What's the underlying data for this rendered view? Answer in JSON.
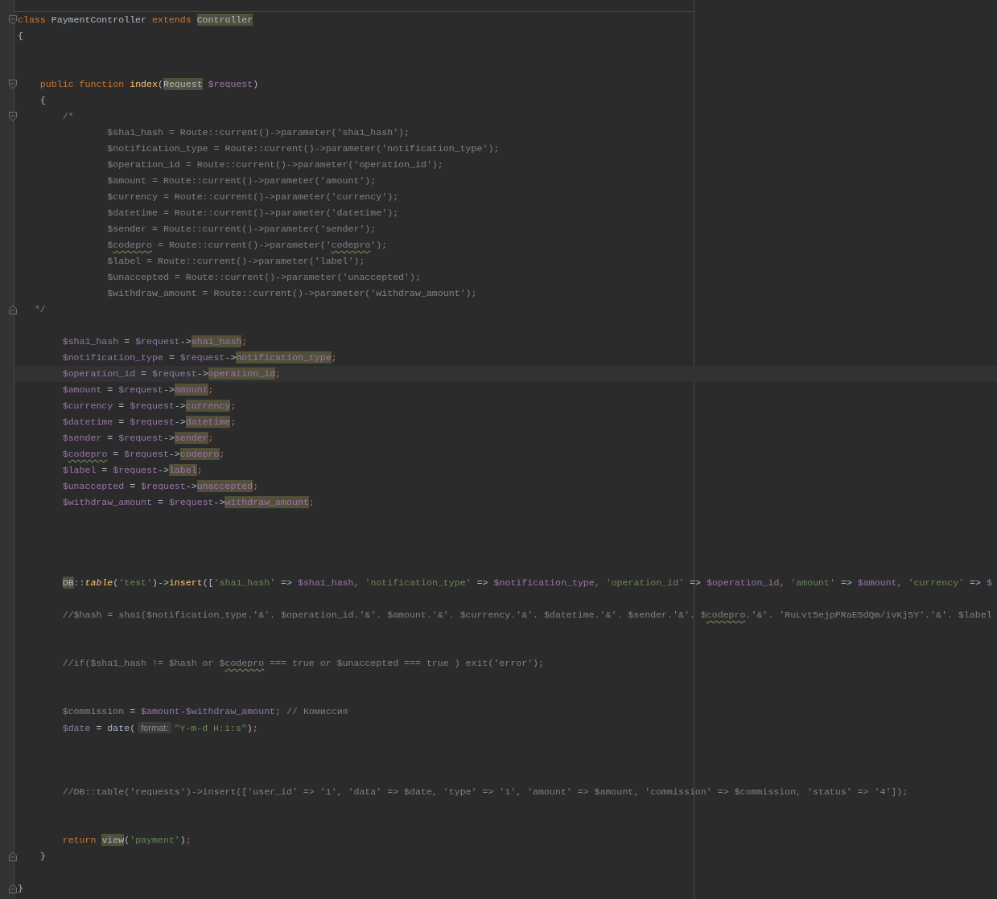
{
  "editor": {
    "lines": [
      {
        "current": false,
        "fold": {
          "kind": "start"
        },
        "tokens": [
          {
            "text": "class ",
            "kind": "kw"
          },
          {
            "text": "PaymentController ",
            "kind": "plain"
          },
          {
            "text": "extends ",
            "kind": "kw"
          },
          {
            "text": "Controller",
            "kind": "hl"
          }
        ]
      },
      {
        "current": false,
        "tokens": [
          {
            "text": "{",
            "kind": "plain"
          }
        ]
      },
      {
        "current": false
      },
      {
        "current": false
      },
      {
        "current": false,
        "fold": {
          "kind": "start"
        },
        "tokens": [
          {
            "text": "    public function ",
            "kind": "kw"
          },
          {
            "text": "index",
            "kind": "fn"
          },
          {
            "text": "(",
            "kind": "plain"
          },
          {
            "text": "Request",
            "kind": "hl"
          },
          {
            "text": " $request",
            "kind": "var"
          },
          {
            "text": ")",
            "kind": "plain"
          }
        ]
      },
      {
        "current": false,
        "tokens": [
          {
            "text": "    {",
            "kind": "plain"
          }
        ]
      },
      {
        "current": false,
        "fold": {
          "kind": "start"
        },
        "tokens": [
          {
            "text": "        /*",
            "kind": "cmt"
          }
        ]
      },
      {
        "current": false,
        "tokens": [
          {
            "text": "                $sha1_hash = Route::current()->parameter('sha1_hash');",
            "kind": "cmt"
          }
        ]
      },
      {
        "current": false,
        "tokens": [
          {
            "text": "                $notification_type = Route::current()->parameter('notification_type');",
            "kind": "cmt"
          }
        ]
      },
      {
        "current": false,
        "tokens": [
          {
            "text": "                $operation_id = Route::current()->parameter('operation_id');",
            "kind": "cmt"
          }
        ]
      },
      {
        "current": false,
        "tokens": [
          {
            "text": "                $amount = Route::current()->parameter('amount');",
            "kind": "cmt"
          }
        ]
      },
      {
        "current": false,
        "tokens": [
          {
            "text": "                $currency = Route::current()->parameter('currency');",
            "kind": "cmt"
          }
        ]
      },
      {
        "current": false,
        "tokens": [
          {
            "text": "                $datetime = Route::current()->parameter('datetime');",
            "kind": "cmt"
          }
        ]
      },
      {
        "current": false,
        "tokens": [
          {
            "text": "                $sender = Route::current()->parameter('sender');",
            "kind": "cmt"
          }
        ]
      },
      {
        "current": false,
        "tokens": [
          {
            "text": "                $",
            "kind": "cmt"
          },
          {
            "text": "codepro",
            "kind": "cmt_typo"
          },
          {
            "text": " = Route::current()->parameter('",
            "kind": "cmt"
          },
          {
            "text": "codepro",
            "kind": "cmt_typo"
          },
          {
            "text": "');",
            "kind": "cmt"
          }
        ]
      },
      {
        "current": false,
        "tokens": [
          {
            "text": "                $label = Route::current()->parameter('label');",
            "kind": "cmt"
          }
        ]
      },
      {
        "current": false,
        "tokens": [
          {
            "text": "                $unaccepted = Route::current()->parameter('unaccepted');",
            "kind": "cmt"
          }
        ]
      },
      {
        "current": false,
        "tokens": [
          {
            "text": "                $withdraw_amount = Route::current()->parameter('withdraw_amount');",
            "kind": "cmt"
          }
        ]
      },
      {
        "current": false,
        "fold": {
          "kind": "end"
        },
        "tokens": [
          {
            "text": "   */",
            "kind": "cmt"
          }
        ]
      },
      {
        "current": false
      },
      {
        "current": false,
        "tokens": [
          {
            "text": "        $sha1_hash",
            "kind": "var"
          },
          {
            "text": " = ",
            "kind": "plain"
          },
          {
            "text": "$request",
            "kind": "var"
          },
          {
            "text": "->",
            "kind": "plain"
          },
          {
            "text": "sha1_hash",
            "kind": "field"
          },
          {
            "text": ";",
            "kind": "punct"
          }
        ]
      },
      {
        "current": false,
        "tokens": [
          {
            "text": "        $notification_type",
            "kind": "var"
          },
          {
            "text": " = ",
            "kind": "plain"
          },
          {
            "text": "$request",
            "kind": "var"
          },
          {
            "text": "->",
            "kind": "plain"
          },
          {
            "text": "notification_type",
            "kind": "field"
          },
          {
            "text": ";",
            "kind": "punct"
          }
        ]
      },
      {
        "current": true,
        "tokens": [
          {
            "text": "        $operation_id",
            "kind": "var"
          },
          {
            "text": " = ",
            "kind": "plain"
          },
          {
            "text": "$request",
            "kind": "var"
          },
          {
            "text": "->",
            "kind": "plain"
          },
          {
            "text": "operation_id",
            "kind": "field"
          },
          {
            "text": ";",
            "kind": "punct"
          }
        ]
      },
      {
        "current": false,
        "tokens": [
          {
            "text": "        $amount",
            "kind": "var"
          },
          {
            "text": " = ",
            "kind": "plain"
          },
          {
            "text": "$request",
            "kind": "var"
          },
          {
            "text": "->",
            "kind": "plain"
          },
          {
            "text": "amount",
            "kind": "field"
          },
          {
            "text": ";",
            "kind": "punct"
          }
        ]
      },
      {
        "current": false,
        "tokens": [
          {
            "text": "        $currency",
            "kind": "var"
          },
          {
            "text": " = ",
            "kind": "plain"
          },
          {
            "text": "$request",
            "kind": "var"
          },
          {
            "text": "->",
            "kind": "plain"
          },
          {
            "text": "currency",
            "kind": "field"
          },
          {
            "text": ";",
            "kind": "punct"
          }
        ]
      },
      {
        "current": false,
        "tokens": [
          {
            "text": "        $datetime",
            "kind": "var"
          },
          {
            "text": " = ",
            "kind": "plain"
          },
          {
            "text": "$request",
            "kind": "var"
          },
          {
            "text": "->",
            "kind": "plain"
          },
          {
            "text": "datetime",
            "kind": "field"
          },
          {
            "text": ";",
            "kind": "punct"
          }
        ]
      },
      {
        "current": false,
        "tokens": [
          {
            "text": "        $sender",
            "kind": "var"
          },
          {
            "text": " = ",
            "kind": "plain"
          },
          {
            "text": "$request",
            "kind": "var"
          },
          {
            "text": "->",
            "kind": "plain"
          },
          {
            "text": "sender",
            "kind": "field"
          },
          {
            "text": ";",
            "kind": "punct"
          }
        ]
      },
      {
        "current": false,
        "tokens": [
          {
            "text": "        $",
            "kind": "var"
          },
          {
            "text": "codepro",
            "kind": "var_typo"
          },
          {
            "text": " = ",
            "kind": "plain"
          },
          {
            "text": "$request",
            "kind": "var"
          },
          {
            "text": "->",
            "kind": "plain"
          },
          {
            "text": "codepro",
            "kind": "field"
          },
          {
            "text": ";",
            "kind": "punct"
          }
        ]
      },
      {
        "current": false,
        "tokens": [
          {
            "text": "        $label",
            "kind": "var"
          },
          {
            "text": " = ",
            "kind": "plain"
          },
          {
            "text": "$request",
            "kind": "var"
          },
          {
            "text": "->",
            "kind": "plain"
          },
          {
            "text": "label",
            "kind": "field"
          },
          {
            "text": ";",
            "kind": "punct"
          }
        ]
      },
      {
        "current": false,
        "tokens": [
          {
            "text": "        $unaccepted",
            "kind": "var"
          },
          {
            "text": " = ",
            "kind": "plain"
          },
          {
            "text": "$request",
            "kind": "var"
          },
          {
            "text": "->",
            "kind": "plain"
          },
          {
            "text": "unaccepted",
            "kind": "field"
          },
          {
            "text": ";",
            "kind": "punct"
          }
        ]
      },
      {
        "current": false,
        "tokens": [
          {
            "text": "        $withdraw_amount",
            "kind": "var"
          },
          {
            "text": " = ",
            "kind": "plain"
          },
          {
            "text": "$request",
            "kind": "var"
          },
          {
            "text": "->",
            "kind": "plain"
          },
          {
            "text": "withdraw_amount",
            "kind": "field"
          },
          {
            "text": ";",
            "kind": "punct"
          }
        ]
      },
      {
        "current": false
      },
      {
        "current": false
      },
      {
        "current": false
      },
      {
        "current": false
      },
      {
        "current": false,
        "tokens": [
          {
            "text": "        DB",
            "kind": "hl"
          },
          {
            "text": "::",
            "kind": "plain"
          },
          {
            "text": "table",
            "kind": "fn_i"
          },
          {
            "text": "(",
            "kind": "plain"
          },
          {
            "text": "'test'",
            "kind": "str"
          },
          {
            "text": ")->",
            "kind": "plain"
          },
          {
            "text": "insert",
            "kind": "fn"
          },
          {
            "text": "([",
            "kind": "plain"
          },
          {
            "text": "'sha1_hash'",
            "kind": "str"
          },
          {
            "text": " => ",
            "kind": "plain"
          },
          {
            "text": "$sha1_hash",
            "kind": "var"
          },
          {
            "text": ",",
            "kind": "punct"
          },
          {
            "text": " 'notification_type'",
            "kind": "str"
          },
          {
            "text": " => ",
            "kind": "plain"
          },
          {
            "text": "$notification_type",
            "kind": "var"
          },
          {
            "text": ",",
            "kind": "punct"
          },
          {
            "text": " 'operation_id'",
            "kind": "str"
          },
          {
            "text": " => ",
            "kind": "plain"
          },
          {
            "text": "$operation_id",
            "kind": "var"
          },
          {
            "text": ",",
            "kind": "punct"
          },
          {
            "text": " 'amount'",
            "kind": "str"
          },
          {
            "text": " => ",
            "kind": "plain"
          },
          {
            "text": "$amount",
            "kind": "var"
          },
          {
            "text": ",",
            "kind": "punct"
          },
          {
            "text": " 'currency'",
            "kind": "str"
          },
          {
            "text": " => ",
            "kind": "plain"
          },
          {
            "text": "$",
            "kind": "var"
          }
        ]
      },
      {
        "current": false
      },
      {
        "current": false,
        "tokens": [
          {
            "text": "        //$hash = sha1($notification_type.'&'. $operation_id.'&'. $amount.'&'. $currency.'&'. $datetime.'&'. $sender.'&'. $",
            "kind": "cmt"
          },
          {
            "text": "codepro",
            "kind": "cmt_typo"
          },
          {
            "text": ".'&'. 'RuLvt5ejpPRaE5dQm/ivKj5Y'.'&'. $label",
            "kind": "cmt"
          }
        ]
      },
      {
        "current": false
      },
      {
        "current": false
      },
      {
        "current": false,
        "tokens": [
          {
            "text": "        //if($sha1_hash != $hash or $",
            "kind": "cmt"
          },
          {
            "text": "codepro",
            "kind": "cmt_typo"
          },
          {
            "text": " === true or $unaccepted === true ) exit('error');",
            "kind": "cmt"
          }
        ]
      },
      {
        "current": false
      },
      {
        "current": false
      },
      {
        "current": false,
        "tokens": [
          {
            "text": "        $commission",
            "kind": "var_unused"
          },
          {
            "text": " = ",
            "kind": "plain"
          },
          {
            "text": "$amount-$withdraw_amount",
            "kind": "var"
          },
          {
            "text": ";",
            "kind": "punct"
          },
          {
            "text": " // Комиссия",
            "kind": "cmt"
          }
        ]
      },
      {
        "current": false,
        "tokens": [
          {
            "text": "        $date",
            "kind": "var_unused"
          },
          {
            "text": " = ",
            "kind": "plain"
          },
          {
            "text": "date(",
            "kind": "plain"
          },
          {
            "text": "format:",
            "kind": "hint"
          },
          {
            "text": "\"Y-m-d H:i:s\"",
            "kind": "str"
          },
          {
            "text": ")",
            "kind": "plain"
          },
          {
            "text": ";",
            "kind": "punct"
          }
        ]
      },
      {
        "current": false
      },
      {
        "current": false
      },
      {
        "current": false
      },
      {
        "current": false,
        "tokens": [
          {
            "text": "        //DB::table('requests')->insert(['user_id' => '1', 'data' => $date, 'type' => '1', 'amount' => $amount, 'commission' => $commission, 'status' => '4']);",
            "kind": "cmt"
          }
        ]
      },
      {
        "current": false
      },
      {
        "current": false
      },
      {
        "current": false,
        "tokens": [
          {
            "text": "        return ",
            "kind": "kw"
          },
          {
            "text": "view",
            "kind": "hl"
          },
          {
            "text": "(",
            "kind": "plain"
          },
          {
            "text": "'payment'",
            "kind": "str"
          },
          {
            "text": ")",
            "kind": "plain"
          },
          {
            "text": ";",
            "kind": "punct"
          }
        ]
      },
      {
        "current": false,
        "fold": {
          "kind": "end"
        },
        "tokens": [
          {
            "text": "    }",
            "kind": "plain"
          }
        ]
      },
      {
        "current": false
      },
      {
        "current": false,
        "fold": {
          "kind": "end"
        },
        "tokens": [
          {
            "text": "}",
            "kind": "plain"
          }
        ]
      }
    ]
  }
}
